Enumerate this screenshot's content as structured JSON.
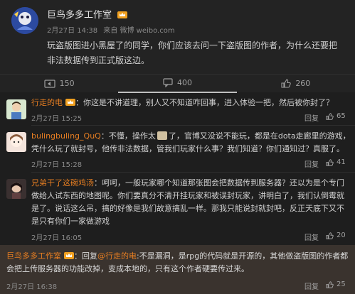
{
  "post": {
    "author": "巨鸟多多工作室",
    "date": "2月27日 14:38",
    "source": "来自 微博 weibo.com",
    "text": "玩盗版图进小黑屋了的同学，你们应该去问一下盗版图的作者，为什么还要把非法数据传到正式版这边。",
    "actions": {
      "repost_count": "150",
      "comment_count": "400",
      "like_count": "260"
    }
  },
  "comments": [
    {
      "name": "行走的电",
      "text": "你这是不讲道理，别人又不知道咋回事，进入体验一把，然后被你封了？",
      "date": "2月27日 15:25",
      "reply": "回复",
      "likes": "65"
    },
    {
      "name": "bulingbuling_QuQ",
      "text": "不懂，操作太",
      "text2": "了，官博又没说不能玩，都是在dota走廊里的游戏，凭什么玩了就封号，他传非法数据，管我们玩家什么事？我们知道？你们通知过？真服了。",
      "date": "2月27日 15:28",
      "reply": "回复",
      "likes": "41"
    },
    {
      "name": "兄弟干了这碗鸡汤",
      "text": "呵呵，一般玩家哪个知道那张图会把数据传到服务器？还以为是个专门做给人试东西的地图呢。你们要真分不清开挂玩家和被误封玩家，讲明白了，我们认倒霉就是了。说话这么吊，搞的好像是我们故意搞乱一样。那我只能说封就封吧，反正天底下又不是只有你们一家做游戏",
      "date": "2月27日 16:05",
      "reply": "回复",
      "likes": "20"
    },
    {
      "name": "巨鸟多多工作室",
      "text_prefix": "回复",
      "mention": "@行走的电",
      "text": ":不是漏洞，是rpg的代码就是开源的，其他做盗版图的作者都会把上传服务器的功能改掉，变成本地的，只有这个作者硬要传过来。",
      "date": "2月27日 16:38",
      "reply": "回复",
      "likes": "25"
    }
  ],
  "colors": {
    "background": "#1e1e1e",
    "name_orange": "#e67e22",
    "highlight_bg": "#3a332e",
    "crown_gold": "#f0a020"
  }
}
